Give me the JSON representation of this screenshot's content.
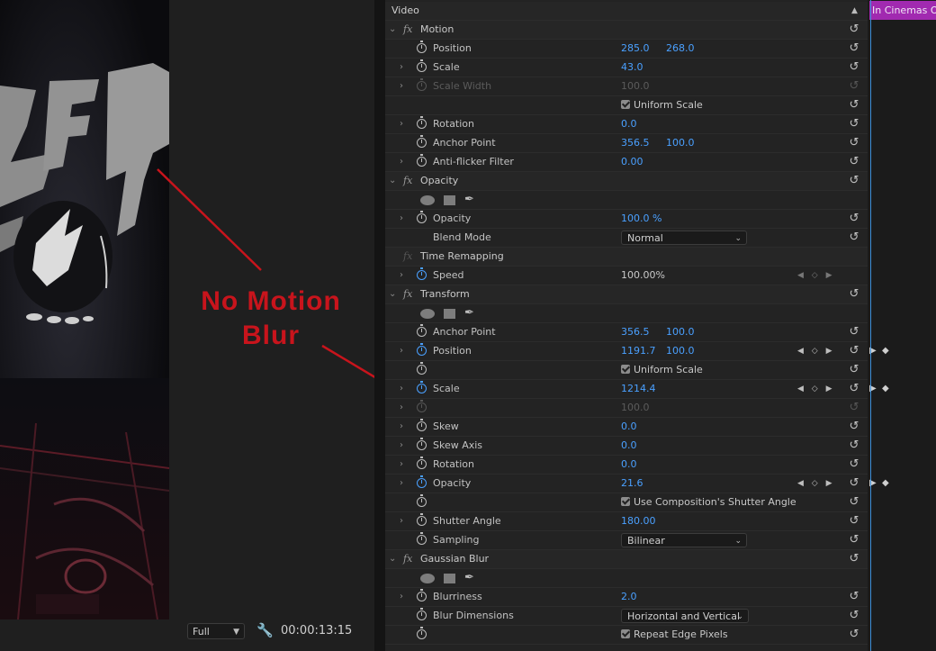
{
  "annotation": {
    "line1": "No Motion",
    "line2": "Blur"
  },
  "bottom_bar": {
    "zoom": "Full",
    "timecode": "00:00:13:15"
  },
  "timeline": {
    "clip_label": "In Cinemas Oct"
  },
  "panel": {
    "video_header": "Video",
    "rows": {
      "motion": "Motion",
      "m_position": {
        "label": "Position",
        "x": "285.0",
        "y": "268.0"
      },
      "m_scale": {
        "label": "Scale",
        "v": "43.0"
      },
      "m_scale_width": {
        "label": "Scale Width",
        "v": "100.0"
      },
      "m_uniform": "Uniform Scale",
      "m_rotation": {
        "label": "Rotation",
        "v": "0.0"
      },
      "m_anchor": {
        "label": "Anchor Point",
        "x": "356.5",
        "y": "100.0"
      },
      "m_antiflicker": {
        "label": "Anti-flicker Filter",
        "v": "0.00"
      },
      "opacity": "Opacity",
      "o_opacity": {
        "label": "Opacity",
        "v": "100.0 %"
      },
      "o_blend": {
        "label": "Blend Mode",
        "v": "Normal"
      },
      "time_remap": "Time Remapping",
      "t_speed": {
        "label": "Speed",
        "v": "100.00%"
      },
      "transform": "Transform",
      "tr_anchor": {
        "label": "Anchor Point",
        "x": "356.5",
        "y": "100.0"
      },
      "tr_position": {
        "label": "Position",
        "x": "1191.7",
        "y": "100.0"
      },
      "tr_uniform": "Uniform Scale",
      "tr_scale": {
        "label": "Scale",
        "v": "1214.4"
      },
      "tr_scale_width": {
        "v": "100.0"
      },
      "tr_skew": {
        "label": "Skew",
        "v": "0.0"
      },
      "tr_skew_axis": {
        "label": "Skew Axis",
        "v": "0.0"
      },
      "tr_rotation": {
        "label": "Rotation",
        "v": "0.0"
      },
      "tr_opacity": {
        "label": "Opacity",
        "v": "21.6"
      },
      "tr_use_comp": "Use Composition's Shutter Angle",
      "tr_shutter": {
        "label": "Shutter Angle",
        "v": "180.00"
      },
      "tr_sampling": {
        "label": "Sampling",
        "v": "Bilinear"
      },
      "gaussian": "Gaussian Blur",
      "g_blurriness": {
        "label": "Blurriness",
        "v": "2.0"
      },
      "g_dimensions": {
        "label": "Blur Dimensions",
        "v": "Horizontal and Vertical"
      },
      "g_repeat": "Repeat Edge Pixels"
    }
  },
  "colors": {
    "accent": "#4aa0ff",
    "annotation": "#c8141c",
    "clip": "#a12ab0"
  }
}
